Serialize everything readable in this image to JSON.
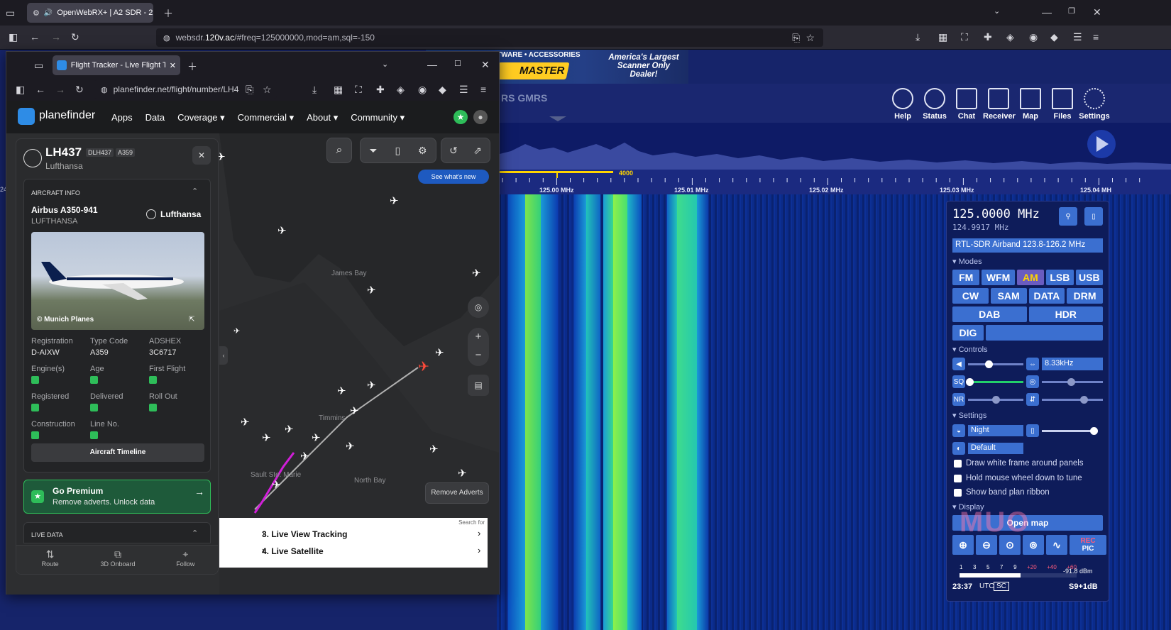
{
  "outer_browser": {
    "tab_title": "OpenWebRX+ | A2 SDR - 2",
    "url_prefix": "websdr.",
    "url_domain": "120v.ac",
    "url_rest": "/#freq=125000000,mod=am,sql=-150"
  },
  "banner": {
    "line1": "TWARE • ACCESSORIES",
    "brand": "MASTER",
    "slogan": "America's Largest Scanner Only Dealer!"
  },
  "sdr": {
    "receiver_label": "RS GMRS",
    "toolbar": [
      "Help",
      "Status",
      "Chat",
      "Receiver",
      "Map",
      "Files",
      "Settings"
    ],
    "bookmark_value": "4000",
    "scale_labels": [
      "125.00 MHz",
      "125.01 MHz",
      "125.02 MHz",
      "125.03 MHz",
      "125.04 MH"
    ],
    "scale_left": "24",
    "frequency": "125.0000 MHz",
    "offset_freq": "124.9917 MHz",
    "profile": "RTL-SDR Airband 123.8-126.2 MHz",
    "modes_label": "▾ Modes",
    "modes_row1": [
      "FM",
      "WFM",
      "AM",
      "LSB",
      "USB"
    ],
    "modes_row2": [
      "CW",
      "SAM",
      "DATA",
      "DRM"
    ],
    "modes_row3": [
      "DAB",
      "HDR"
    ],
    "dig": "DIG",
    "controls_label": "▾ Controls",
    "bandwidth": "8.33kHz",
    "sq": "SQ",
    "nr": "NR",
    "settings_label": "▾ Settings",
    "theme": "Night",
    "palette": "Default",
    "checkboxes": [
      "Draw white frame around panels",
      "Hold mouse wheel down to tune",
      "Show band plan ribbon"
    ],
    "display_label": "▾ Display",
    "open_map": "Open map",
    "rec": "REC",
    "pic": "PIC",
    "smeter_ticks": [
      "1",
      "3",
      "5",
      "7",
      "9",
      "+20",
      "+40",
      "+60"
    ],
    "dbm": "-91.8 dBm",
    "time": "23:37",
    "utc": "UTC",
    "sc": "SC",
    "s_level": "S9+1dB",
    "watermark": "MUO",
    "accent_yellow": "#ffd400",
    "accent_blue": "#3b6fd0"
  },
  "inner_browser": {
    "tab_title": "Flight Tracker - Live Flight Track",
    "url": "planefinder.net/flight/number/LH4"
  },
  "planefinder": {
    "logo": "planefinder",
    "nav": [
      "Apps",
      "Data",
      "Coverage ▾",
      "Commercial ▾",
      "About ▾",
      "Community ▾"
    ],
    "see_new": "See what's new",
    "remove_adverts": "Remove Adverts",
    "flight": {
      "number": "LH437",
      "callsign": "DLH437",
      "type_badge": "A359",
      "airline": "Lufthansa",
      "section_info": "AIRCRAFT INFO",
      "model": "Airbus A350-941",
      "operator": "LUFTHANSA",
      "airline_logo": "Lufthansa",
      "photo_credit": "© Munich Planes",
      "fields": [
        {
          "label": "Registration",
          "value": "D-AIXW"
        },
        {
          "label": "Type Code",
          "value": "A359"
        },
        {
          "label": "ADSHEX",
          "value": "3C6717"
        }
      ],
      "locked": [
        [
          "Engine(s)",
          "Age",
          "First Flight"
        ],
        [
          "Registered",
          "Delivered",
          "Roll Out"
        ],
        [
          "Construction",
          "Line No."
        ]
      ],
      "timeline": "Aircraft Timeline",
      "premium_title": "Go Premium",
      "premium_sub": "Remove adverts. Unlock data",
      "live_data": "LIVE DATA",
      "bottom": [
        "Route",
        "3D Onboard",
        "Follow"
      ]
    },
    "map_labels": [
      "James Bay",
      "Timmins",
      "Sault Ste. Marie",
      "North Bay"
    ],
    "ad": {
      "search": "Search for",
      "items": [
        "3.  Live View Tracking",
        "4.  Live Satellite"
      ]
    }
  }
}
